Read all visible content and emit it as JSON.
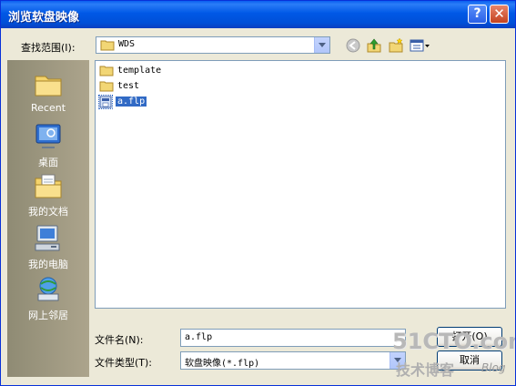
{
  "window": {
    "title": "浏览软盘映像"
  },
  "titlebar": {
    "help_symbol": "?",
    "close_symbol": "✕"
  },
  "lookin": {
    "label": "查找范围(I):",
    "value": "WDS"
  },
  "toolbar": {
    "back_icon": "back-arrow-icon",
    "up_icon": "up-folder-icon",
    "new_folder_icon": "new-folder-icon",
    "views_icon": "views-menu-icon"
  },
  "places": [
    {
      "label": "Recent",
      "icon": "recent-folder-icon"
    },
    {
      "label": "桌面",
      "icon": "desktop-icon"
    },
    {
      "label": "我的文档",
      "icon": "my-documents-icon"
    },
    {
      "label": "我的电脑",
      "icon": "my-computer-icon"
    },
    {
      "label": "网上邻居",
      "icon": "network-places-icon"
    }
  ],
  "files": [
    {
      "name": "template",
      "type": "folder"
    },
    {
      "name": "test",
      "type": "folder"
    },
    {
      "name": "a.flp",
      "type": "file",
      "selected": true
    }
  ],
  "filename": {
    "label": "文件名(N):",
    "value": "a.flp"
  },
  "filetype": {
    "label": "文件类型(T):",
    "value": "软盘映像(*.flp)"
  },
  "buttons": {
    "open": "打开(O)",
    "cancel": "取消"
  },
  "watermark": {
    "site": "51CTO.com",
    "subtitle": "技术博客",
    "blog": "Blog"
  },
  "colors": {
    "titlebar": "#0058e6",
    "dialog_bg": "#ece9d8",
    "selection": "#316ac5",
    "places_bar": "#aca48c"
  }
}
